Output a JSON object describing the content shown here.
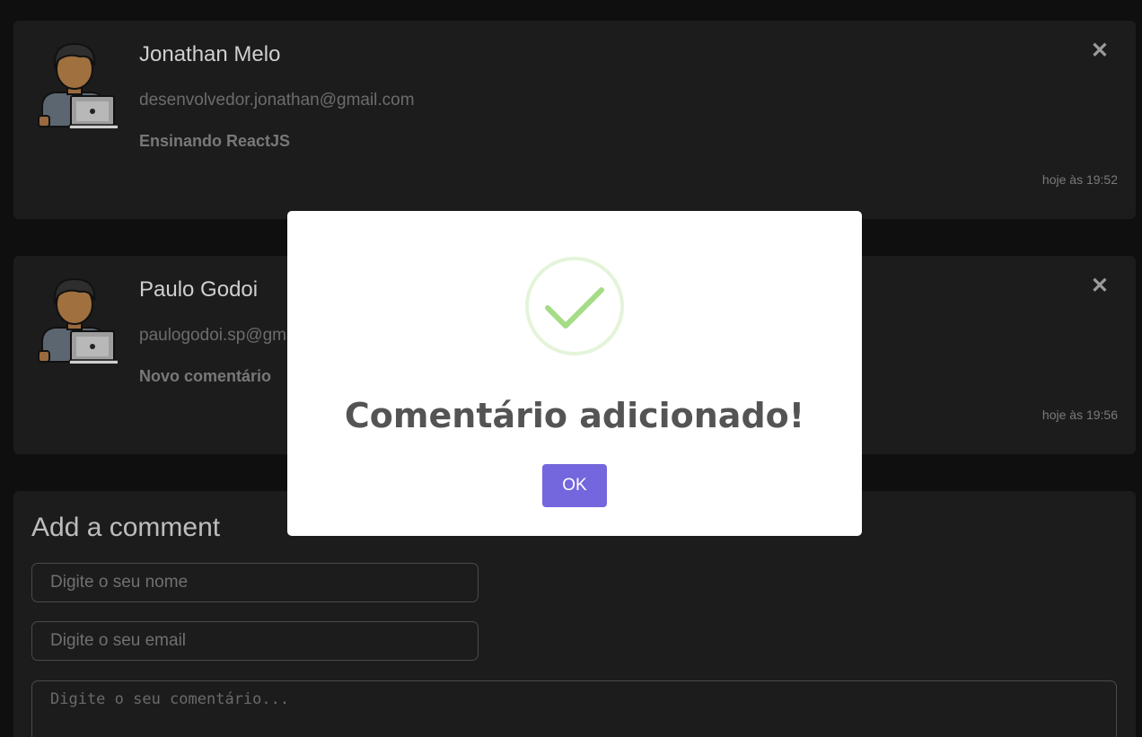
{
  "comments": [
    {
      "name": "Jonathan Melo",
      "email": "desenvolvedor.jonathan@gmail.com",
      "message": "Ensinando ReactJS",
      "time": "hoje às 19:52",
      "close_symbol": "✕"
    },
    {
      "name": "Paulo Godoi",
      "email": "paulogodoi.sp@gmail.com",
      "message": "Novo comentário",
      "time": "hoje às 19:56",
      "close_symbol": "✕"
    }
  ],
  "form": {
    "title": "Add a comment",
    "name_placeholder": "Digite o seu nome",
    "email_placeholder": "Digite o seu email",
    "comment_placeholder": "Digite o seu comentário..."
  },
  "modal": {
    "icon": "success-check-icon",
    "title": "Comentário adicionado!",
    "ok_label": "OK"
  },
  "colors": {
    "background": "#0f0f0f",
    "card": "#1c1c1c",
    "button": "#7466dd",
    "success": "#a5dc86"
  }
}
